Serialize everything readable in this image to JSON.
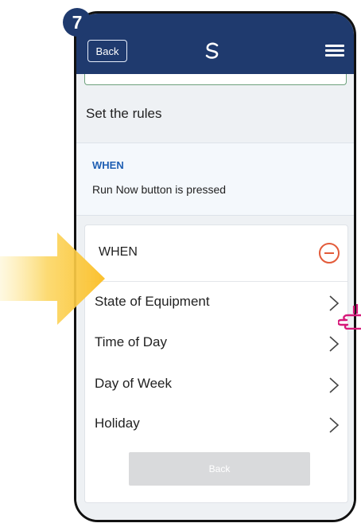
{
  "step_number": "7",
  "header": {
    "back_label": "Back"
  },
  "rules": {
    "title": "Set the rules",
    "when_label": "WHEN",
    "when_condition": "Run Now button is pressed"
  },
  "when_panel": {
    "title": "WHEN",
    "options": [
      {
        "label": "State of Equipment"
      },
      {
        "label": "Time of Day"
      },
      {
        "label": "Day of Week"
      },
      {
        "label": "Holiday"
      }
    ],
    "back_label": "Back"
  },
  "colors": {
    "header_blue": "#1f3a6e",
    "when_blue": "#1f5fb3",
    "remove_red": "#e35b3a",
    "arrow_yellow": "#fbc02d",
    "pointer_pink": "#d6197a"
  },
  "icons": {
    "logo": "salus-swirl-logo",
    "menu": "hamburger-menu-icon",
    "remove": "minus-circle-icon",
    "chevron": "chevron-right-icon",
    "pointer": "tapping-finger-icon",
    "arrow": "pointing-arrow"
  }
}
